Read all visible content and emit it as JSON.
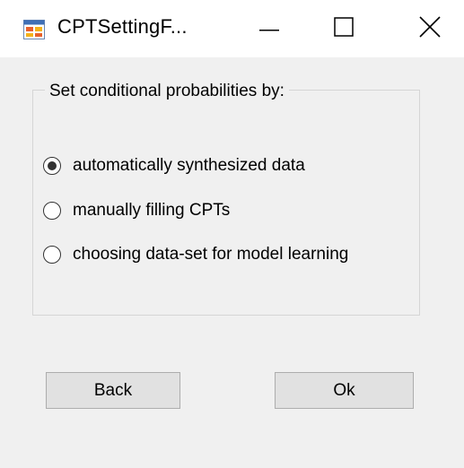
{
  "window": {
    "title": "CPTSettingF...",
    "icon": "app-form-icon",
    "controls": [
      "minimize-icon",
      "maximize-icon",
      "close-icon"
    ]
  },
  "group": {
    "label": "Set conditional probabilities by:",
    "options": [
      {
        "label": "automatically synthesized data",
        "selected": true
      },
      {
        "label": "manually filling CPTs",
        "selected": false
      },
      {
        "label": "choosing data-set for model learning",
        "selected": false
      }
    ]
  },
  "buttons": {
    "back": "Back",
    "ok": "Ok"
  },
  "colors": {
    "window_bg": "#f0f0f0",
    "titlebar_bg": "#ffffff",
    "button_bg": "#e1e1e1",
    "button_border": "#adadad"
  }
}
